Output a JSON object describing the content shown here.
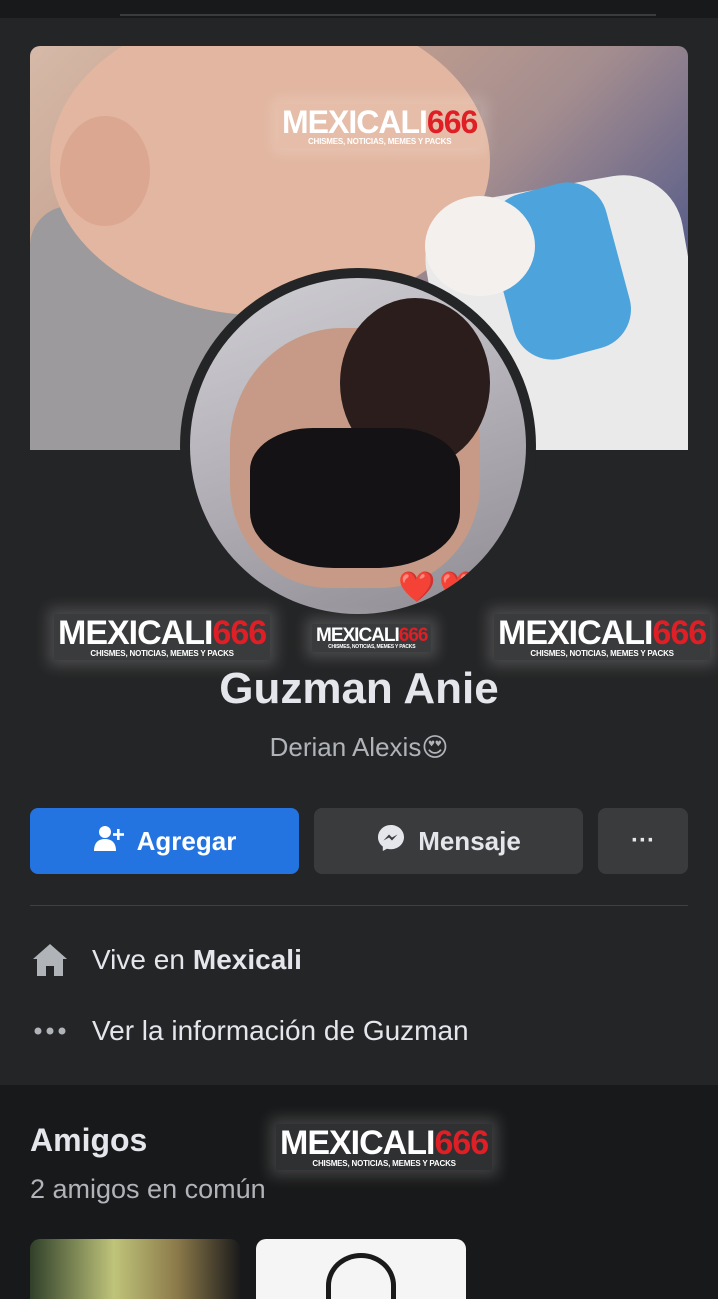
{
  "profile": {
    "name": "Guzman Anie",
    "nickname": "Derian Alexis😍",
    "hearts": "❤️❤️"
  },
  "watermark": {
    "text_white": "MEXICALI",
    "text_red": "666",
    "subtitle": "CHISMES, NOTICIAS, MEMES Y PACKS"
  },
  "actions": {
    "add_label": "Agregar",
    "message_label": "Mensaje",
    "more_label": "···"
  },
  "info": {
    "lives_prefix": "Vive en",
    "lives_city": "Mexicali",
    "more_info": "Ver la información de Guzman"
  },
  "friends": {
    "title": "Amigos",
    "mutual": "2 amigos en común"
  },
  "colors": {
    "background": "#18191a",
    "card": "#242526",
    "primary_button": "#2374e1",
    "secondary_button": "#3a3b3c",
    "watermark_red": "#e01e25"
  },
  "icons": [
    "add-friend-icon",
    "messenger-icon",
    "more-icon",
    "home-icon",
    "dots-icon"
  ]
}
